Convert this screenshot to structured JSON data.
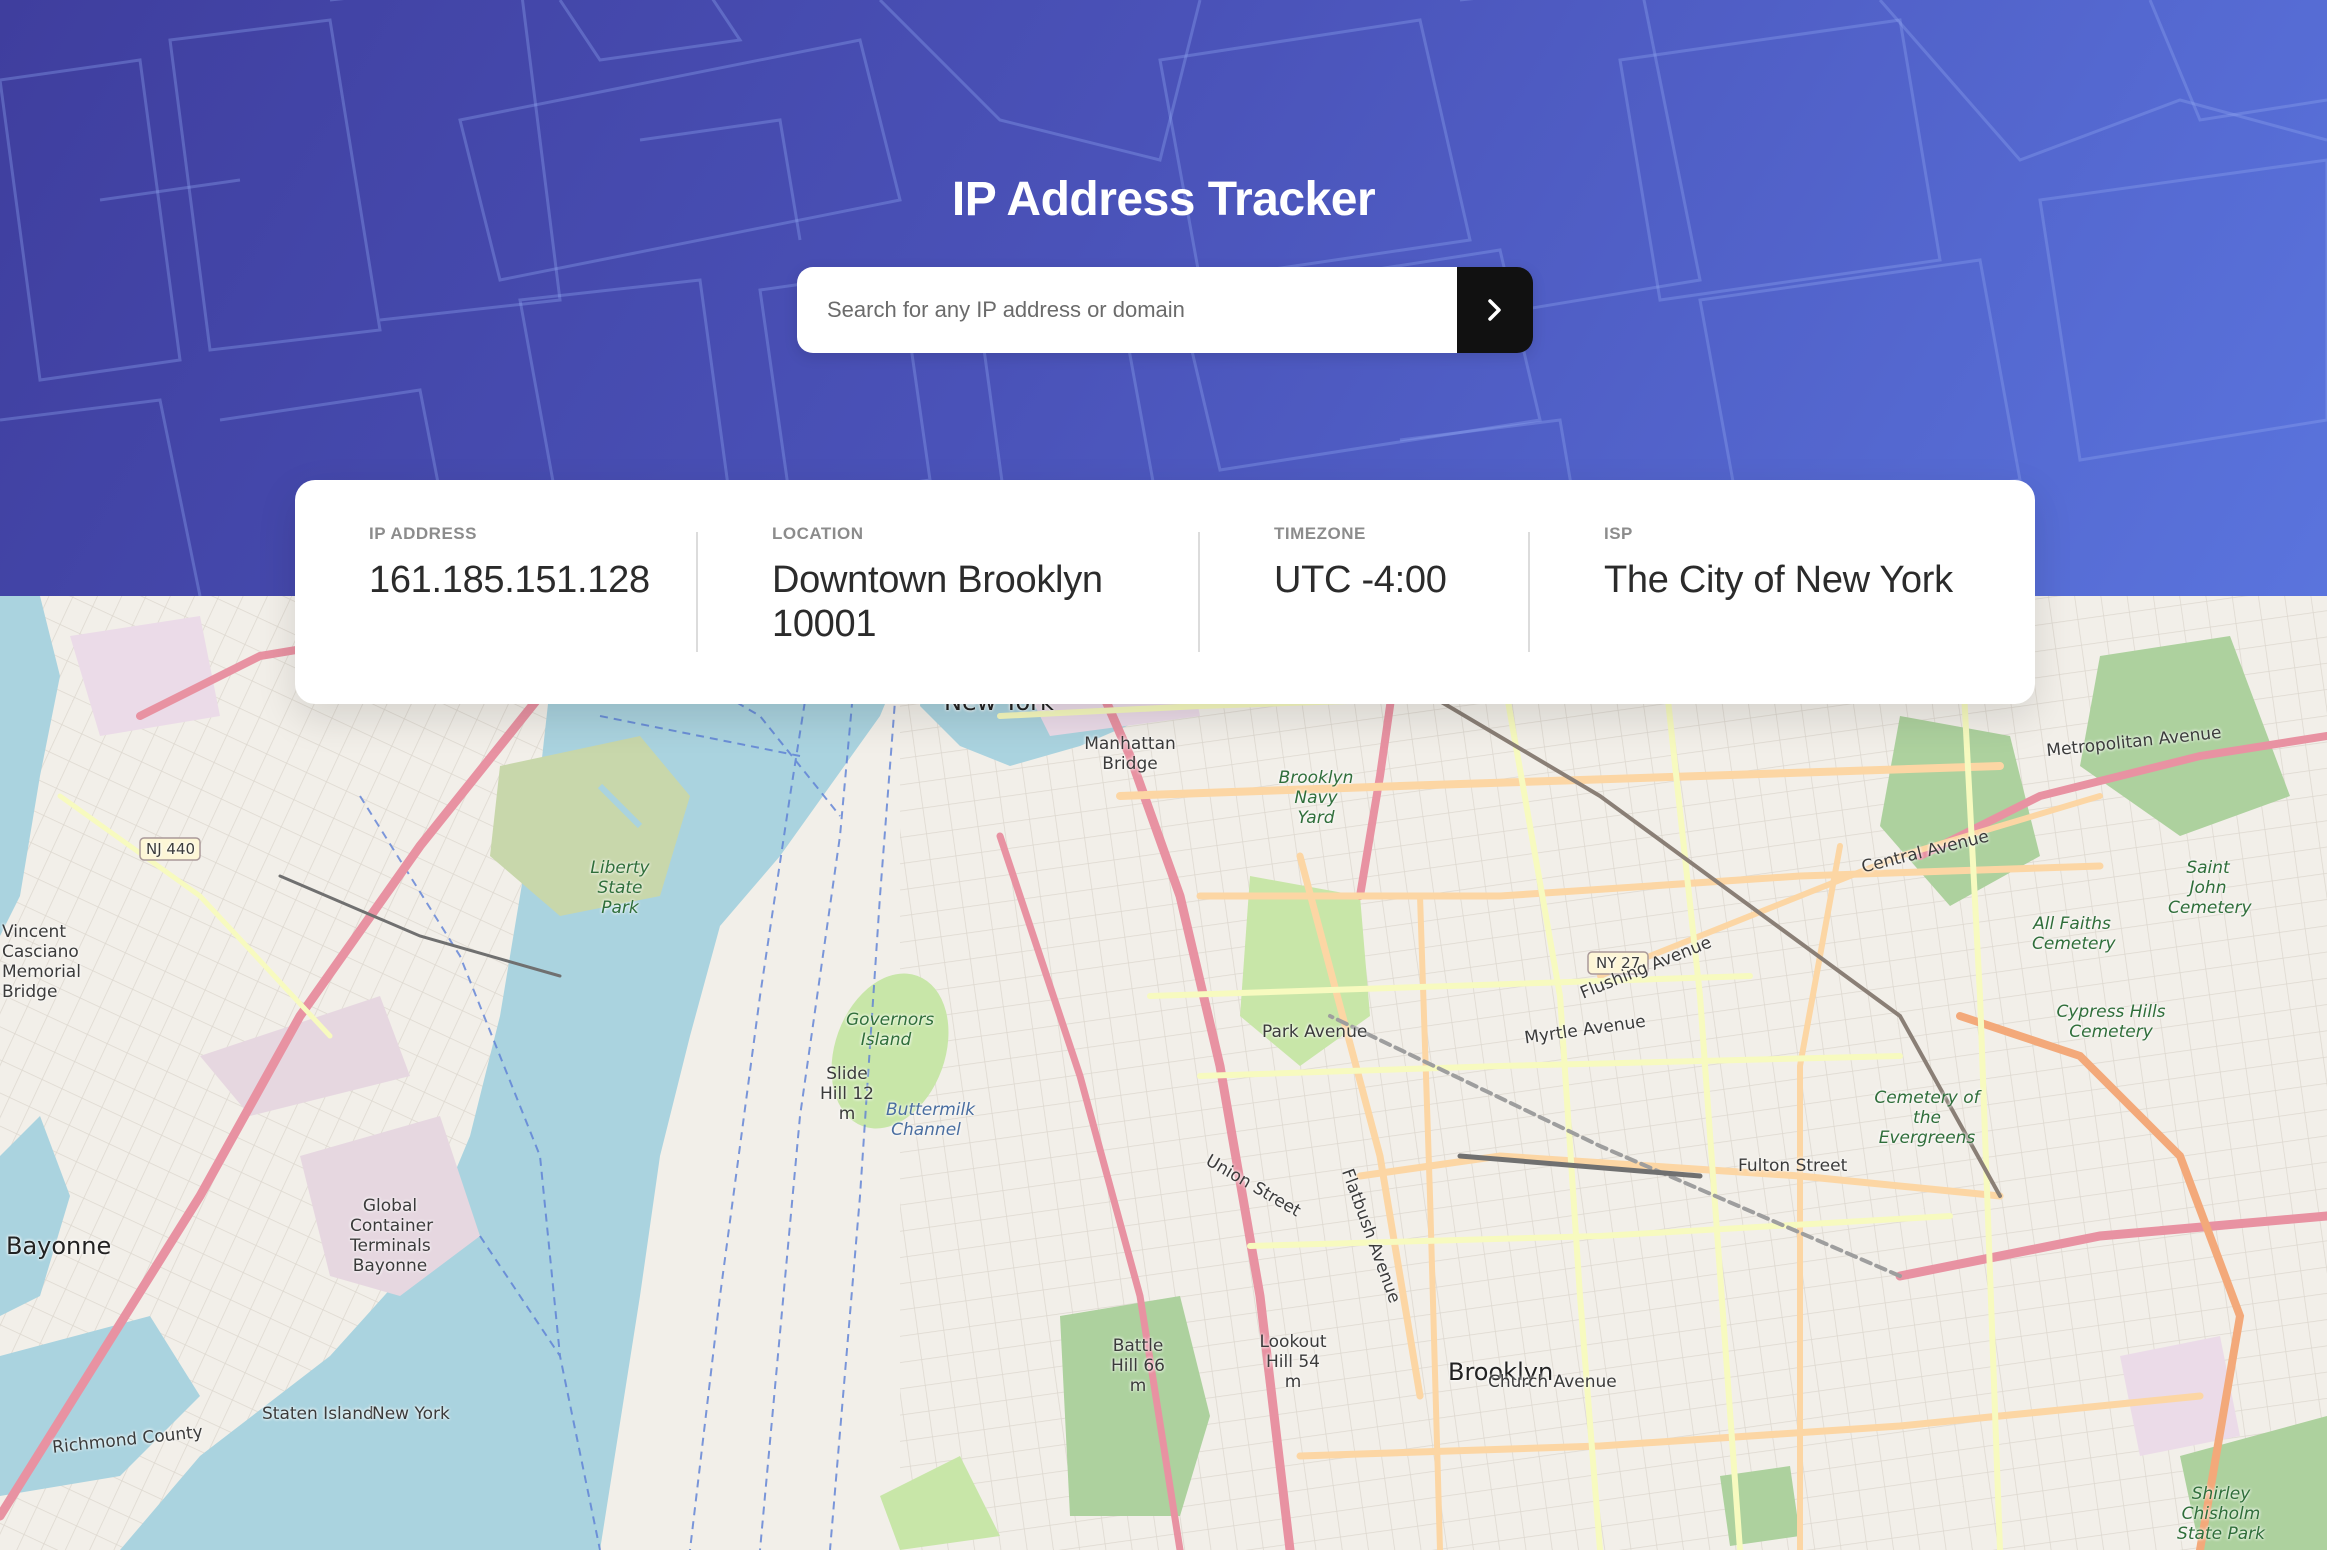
{
  "header": {
    "title": "IP Address Tracker",
    "search": {
      "placeholder": "Search for any IP address or domain",
      "value": "",
      "button_icon": "chevron-right-icon"
    }
  },
  "info": {
    "ip": {
      "label": "IP ADDRESS",
      "value": "161.185.151.128"
    },
    "location": {
      "label": "LOCATION",
      "value_line1": "Downtown Brooklyn",
      "value_line2": "10001"
    },
    "timezone": {
      "label": "TIMEZONE",
      "value": "UTC -4:00"
    },
    "isp": {
      "label": "ISP",
      "value": "The City of New York"
    }
  },
  "map": {
    "labels": {
      "new_york": "New York",
      "manhattan_bridge": "Manhattan Bridge",
      "brooklyn_navy_yard": "Brooklyn Navy Yard",
      "liberty_state_park": "Liberty State Park",
      "governors_island": "Governors Island",
      "buttermilk_channel": "Buttermilk Channel",
      "slide_hill": "Slide Hill 12 m",
      "bayonne": "Bayonne",
      "vincent_bridge": "Vincent Casciano Memorial Bridge",
      "global_terminals": "Global Container Terminals Bayonne",
      "brooklyn": "Brooklyn",
      "battle_hill": "Battle Hill 66 m",
      "lookout_hill": "Lookout Hill 54 m",
      "cemetery_evergreens": "Cemetery of the Evergreens",
      "cypress_hills": "Cypress Hills Cemetery",
      "all_faiths": "All Faiths Cemetery",
      "saint_john": "Saint John Cemetery",
      "shirley_chisholm": "Shirley Chisholm State Park",
      "fulton_street": "Fulton Street",
      "myrtle_avenue": "Myrtle Avenue",
      "flushing_avenue": "Flushing Avenue",
      "park_avenue": "Park Avenue",
      "metropolitan_avenue": "Metropolitan Avenue",
      "central_avenue": "Central Avenue",
      "union_street": "Union Street",
      "flatbush_avenue": "Flatbush Avenue",
      "church_avenue": "Church Avenue",
      "staten_island": "Staten Island",
      "new_york_county": "New York",
      "richmond_county": "Richmond County",
      "nj440": "NJ 440",
      "ny27": "NY 27"
    }
  }
}
